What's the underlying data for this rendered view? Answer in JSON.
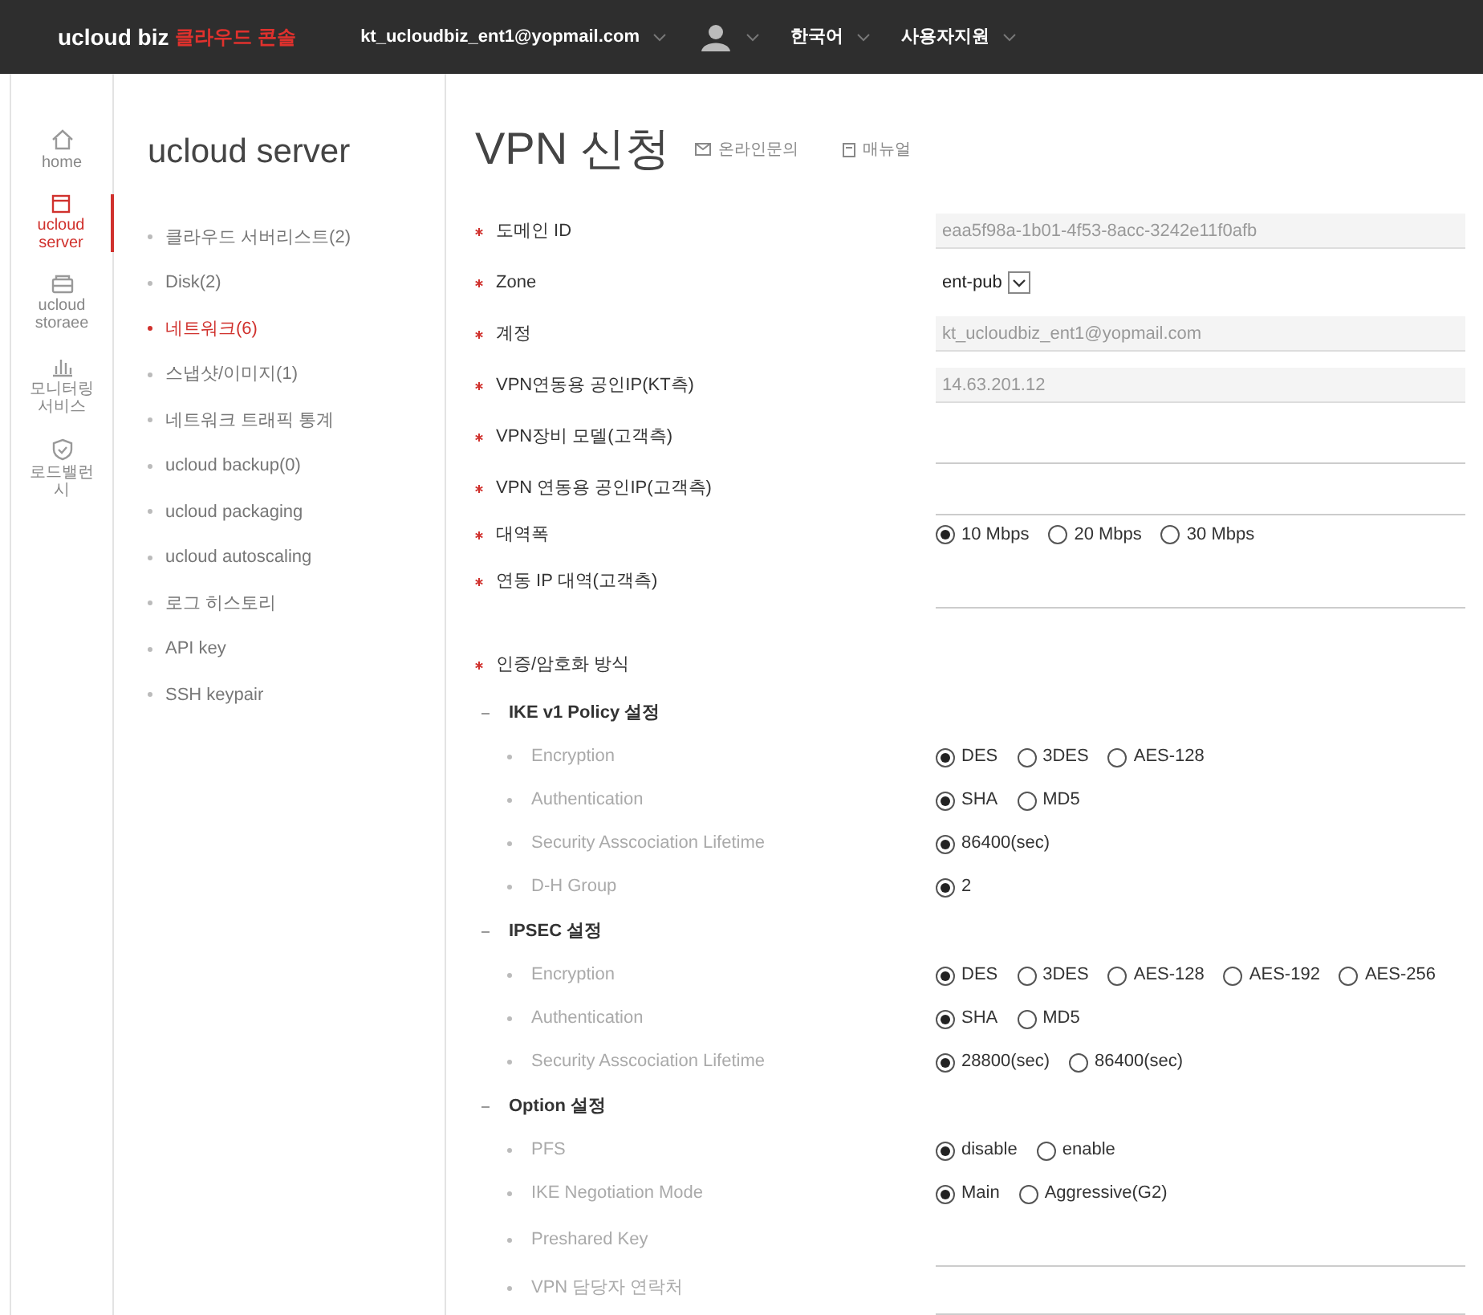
{
  "header": {
    "logo": "ucloud biz",
    "logo_sub": "클라우드 콘솔",
    "menus": [
      {
        "kind": "text",
        "label": "kt_ucloudbiz_ent1@yopmail.com"
      },
      {
        "kind": "avatar"
      },
      {
        "kind": "text",
        "label": "한국어"
      },
      {
        "kind": "text",
        "label": "사용자지원"
      }
    ]
  },
  "rail": [
    {
      "kind": "home",
      "label": "home",
      "selected": false
    },
    {
      "kind": "server",
      "label": "ucloud server",
      "selected": true
    },
    {
      "kind": "storage",
      "label": "ucloud storaee",
      "selected": false
    },
    {
      "kind": "monitor",
      "label": "모니터링 서비스",
      "selected": false
    },
    {
      "kind": "shield",
      "label": "로드밸런시",
      "selected": false
    }
  ],
  "submenu": {
    "title": "ucloud server",
    "items": [
      {
        "label": "클라우드 서버리스트(2)",
        "selected": false
      },
      {
        "label": "Disk(2)",
        "selected": false
      },
      {
        "label": "네트워크(6)",
        "selected": true
      },
      {
        "label": "스냅샷/이미지(1)",
        "selected": false
      },
      {
        "label": "네트워크 트래픽 통계",
        "selected": false
      },
      {
        "label": "ucloud backup(0)",
        "selected": false
      },
      {
        "label": "ucloud packaging",
        "selected": false
      },
      {
        "label": "ucloud autoscaling",
        "selected": false
      },
      {
        "label": "로그 히스토리",
        "selected": false
      },
      {
        "label": "API key",
        "selected": false
      },
      {
        "label": "SSH keypair",
        "selected": false
      }
    ]
  },
  "page": {
    "title": "VPN 신청",
    "links": [
      {
        "kind": "mail",
        "label": "온라인문의"
      },
      {
        "kind": "doc",
        "label": "매뉴얼"
      }
    ]
  },
  "form_rows": [
    {
      "kind": "readonly",
      "label": "도메인 ID",
      "value": "eaa5f98a-1b01-4f53-8acc-3242e11f0afb"
    },
    {
      "kind": "select",
      "label": "Zone",
      "value": "ent-pub"
    },
    {
      "kind": "readonly",
      "label": "계정",
      "value": "kt_ucloudbiz_ent1@yopmail.com"
    },
    {
      "kind": "readonly",
      "label": "VPN연동용 공인IP(KT측)",
      "value": "14.63.201.12"
    },
    {
      "kind": "input",
      "label": "VPN장비 모델(고객측)"
    },
    {
      "kind": "input",
      "label": "VPN 연동용 공인IP(고객측)"
    },
    {
      "kind": "radio",
      "label": "대역폭",
      "options": [
        {
          "label": "10 Mbps",
          "selected": true
        },
        {
          "label": "20 Mbps",
          "selected": false
        },
        {
          "label": "30 Mbps",
          "selected": false
        }
      ]
    },
    {
      "kind": "input",
      "label": "연동 IP 대역(고객측)"
    },
    {
      "kind": "section",
      "label": "인증/암호화 방식"
    },
    {
      "kind": "group",
      "label": "IKE v1 Policy 설정"
    },
    {
      "kind": "subradio",
      "label": "Encryption",
      "options": [
        {
          "label": "DES",
          "selected": true
        },
        {
          "label": "3DES",
          "selected": false
        },
        {
          "label": "AES-128",
          "selected": false
        }
      ]
    },
    {
      "kind": "subradio",
      "label": "Authentication",
      "options": [
        {
          "label": "SHA",
          "selected": true
        },
        {
          "label": "MD5",
          "selected": false
        }
      ]
    },
    {
      "kind": "subradio",
      "label": "Security Asscociation Lifetime",
      "options": [
        {
          "label": "86400(sec)",
          "selected": true
        }
      ]
    },
    {
      "kind": "subradio",
      "label": "D-H Group",
      "options": [
        {
          "label": "2",
          "selected": true
        }
      ]
    },
    {
      "kind": "group",
      "label": "IPSEC 설정"
    },
    {
      "kind": "subradio",
      "label": "Encryption",
      "options": [
        {
          "label": "DES",
          "selected": true
        },
        {
          "label": "3DES",
          "selected": false
        },
        {
          "label": "AES-128",
          "selected": false
        },
        {
          "label": "AES-192",
          "selected": false
        },
        {
          "label": "AES-256",
          "selected": false
        }
      ]
    },
    {
      "kind": "subradio",
      "label": "Authentication",
      "options": [
        {
          "label": "SHA",
          "selected": true
        },
        {
          "label": "MD5",
          "selected": false
        }
      ]
    },
    {
      "kind": "subradio",
      "label": "Security Asscociation Lifetime",
      "options": [
        {
          "label": "28800(sec)",
          "selected": true
        },
        {
          "label": "86400(sec)",
          "selected": false
        }
      ]
    },
    {
      "kind": "group",
      "label": "Option 설정"
    },
    {
      "kind": "subradio",
      "label": "PFS",
      "options": [
        {
          "label": "disable",
          "selected": true
        },
        {
          "label": "enable",
          "selected": false
        }
      ]
    },
    {
      "kind": "subradio",
      "label": "IKE Negotiation Mode",
      "options": [
        {
          "label": "Main",
          "selected": true
        },
        {
          "label": "Aggressive(G2)",
          "selected": false
        }
      ]
    },
    {
      "kind": "subinput",
      "label": "Preshared Key"
    },
    {
      "kind": "subinput",
      "label": "VPN 담당자 연락처"
    }
  ]
}
